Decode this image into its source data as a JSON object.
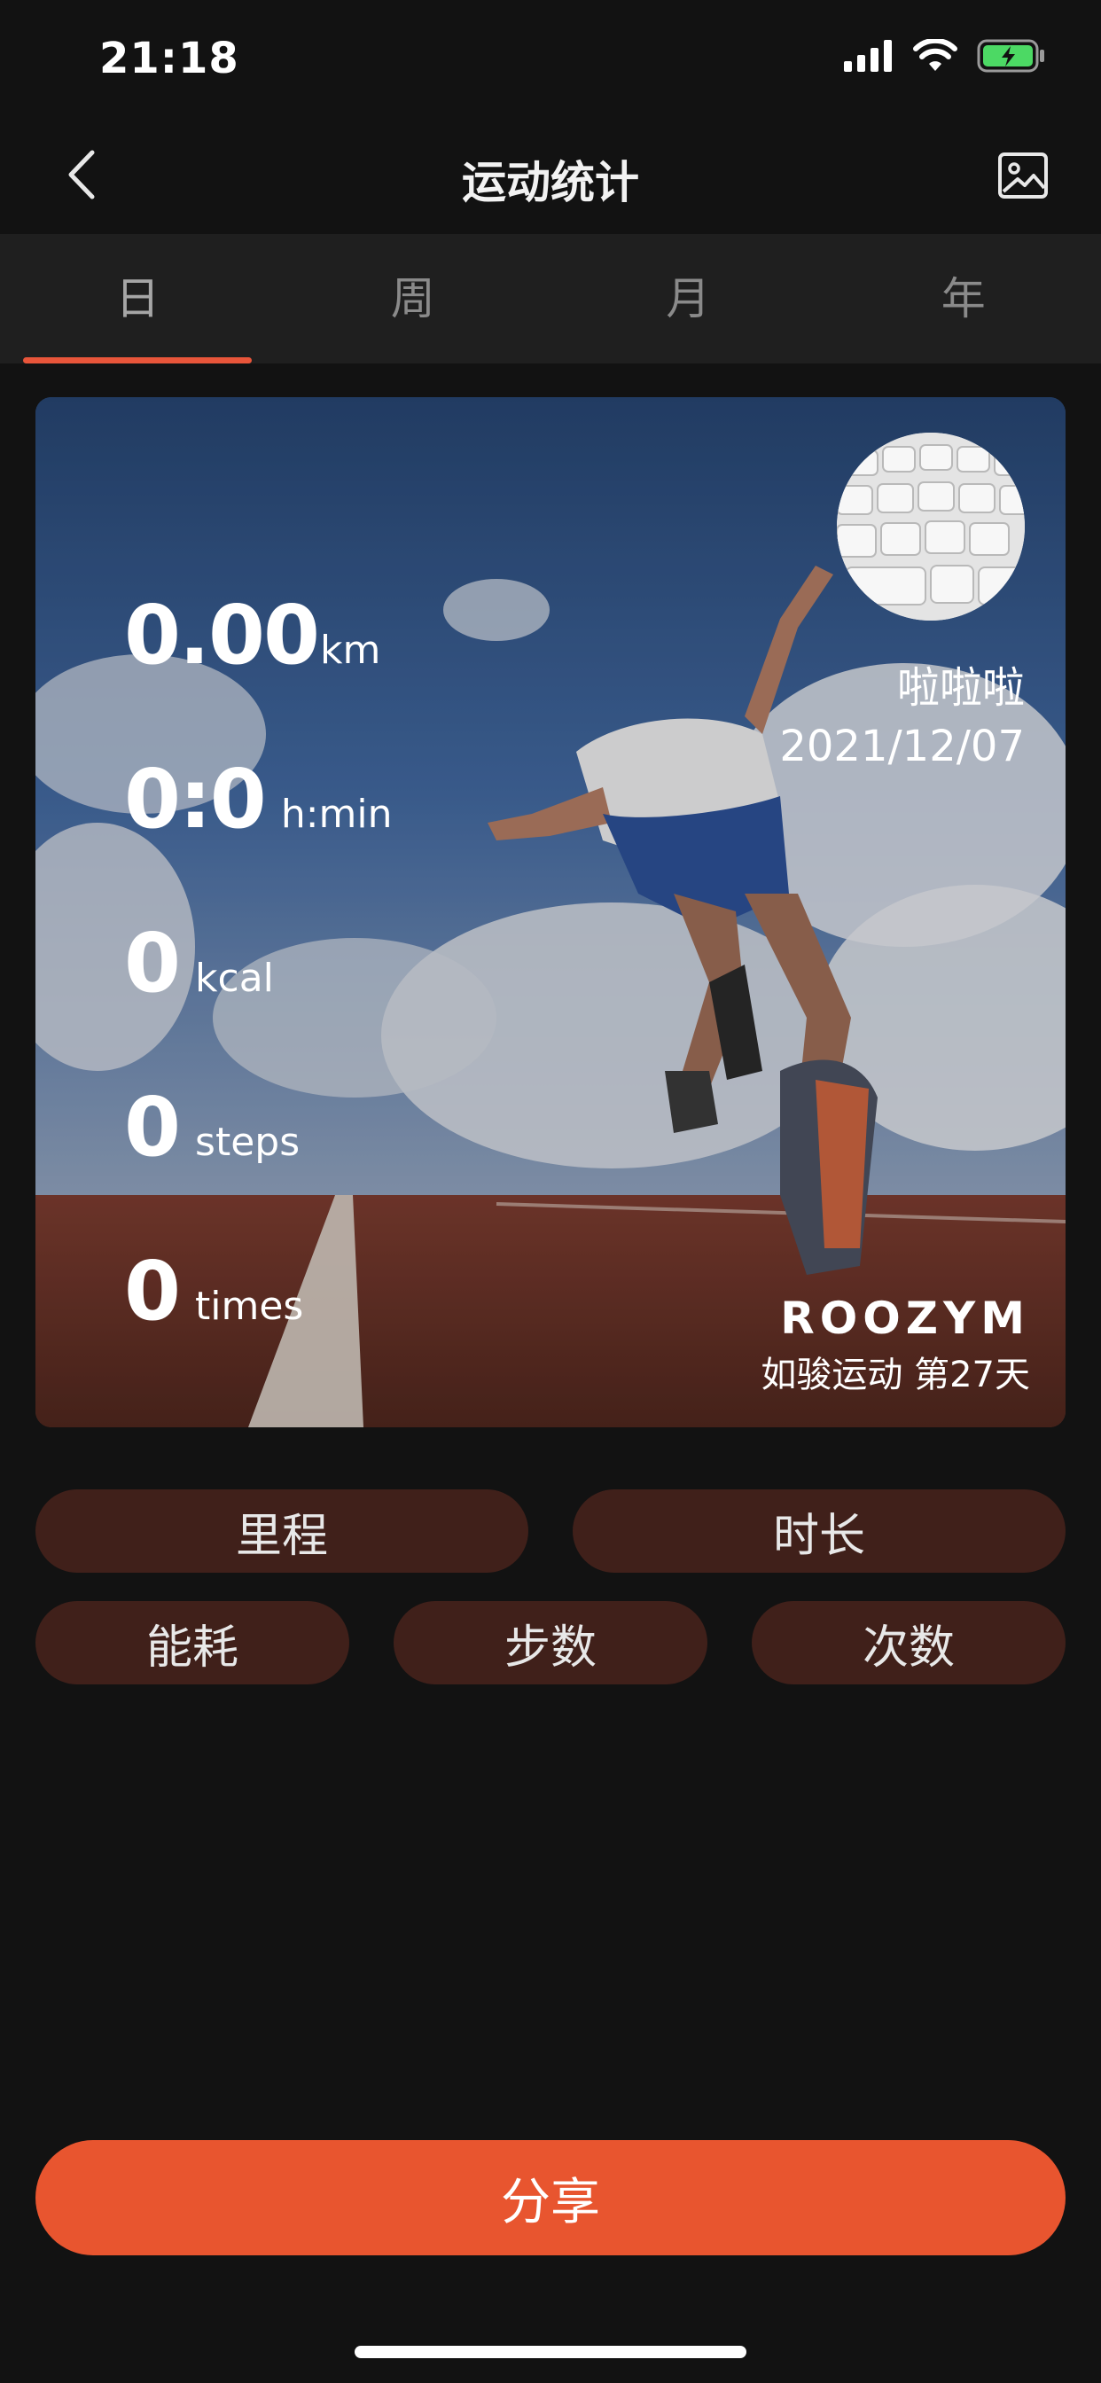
{
  "status_bar": {
    "time": "21:18",
    "icons": [
      "signal-icon",
      "wifi-icon",
      "battery-charging-icon"
    ]
  },
  "nav": {
    "title": "运动统计",
    "back_icon": "chevron-left-icon",
    "image_icon": "image-icon"
  },
  "tabs": [
    {
      "label": "日",
      "active": true
    },
    {
      "label": "周",
      "active": false
    },
    {
      "label": "月",
      "active": false
    },
    {
      "label": "年",
      "active": false
    }
  ],
  "card": {
    "stats": [
      {
        "value": "0.00",
        "unit": "km"
      },
      {
        "value": "0:0",
        "unit": "h:min"
      },
      {
        "value": "0",
        "unit": "kcal"
      },
      {
        "value": "0",
        "unit": "steps"
      },
      {
        "value": "0",
        "unit": "times"
      }
    ],
    "user": {
      "name": "啦啦啦",
      "date": "2021/12/07"
    },
    "brand": {
      "logo": "ROOZYM",
      "subtitle": "如骏运动 第27天"
    }
  },
  "chips": {
    "row1": [
      "里程",
      "时长"
    ],
    "row2": [
      "能耗",
      "步数",
      "次数"
    ]
  },
  "share_label": "分享",
  "colors": {
    "accent": "#e8552f",
    "chip_bg": "#40201a",
    "background": "#121212",
    "tab_bg": "#1f1f1f"
  }
}
